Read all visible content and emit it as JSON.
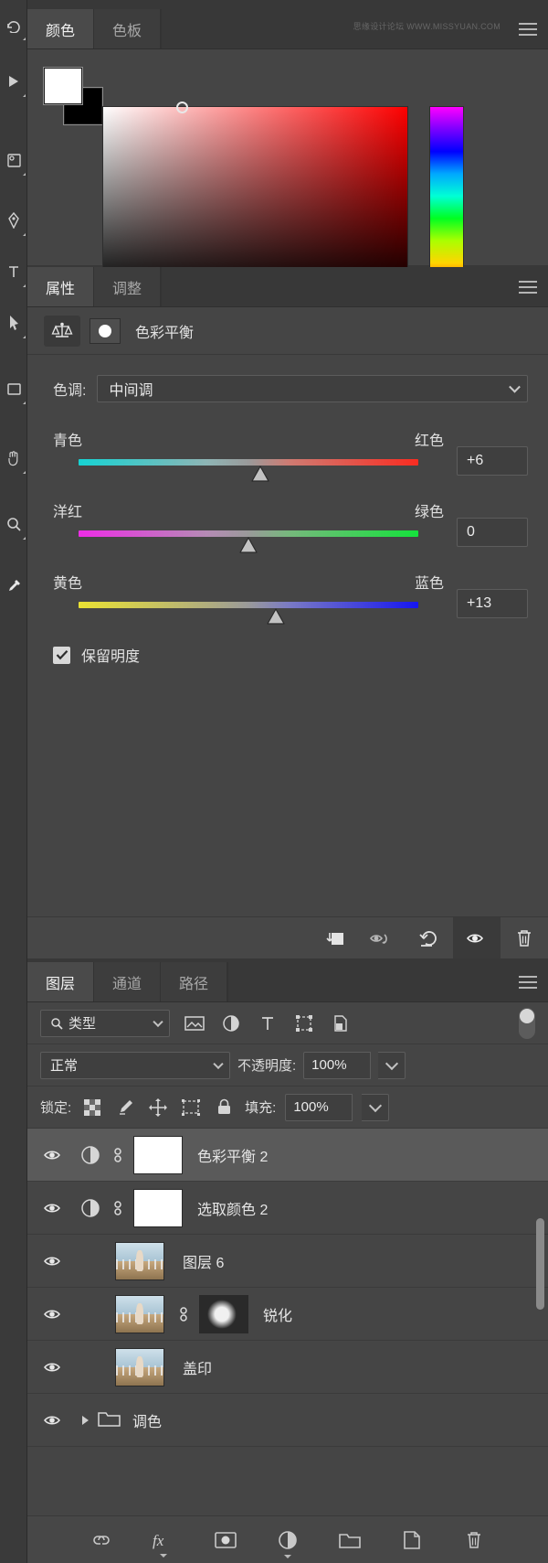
{
  "watermark": "思缘设计论坛  WWW.MISSYUAN.COM",
  "toolbar": {
    "tools": [
      {
        "name": "history-brush-tool"
      },
      {
        "name": "gradient-tool"
      },
      {
        "name": "dodge-tool"
      },
      {
        "name": "pen-tool"
      },
      {
        "name": "type-tool"
      },
      {
        "name": "path-selection-tool"
      },
      {
        "name": "rectangle-tool"
      },
      {
        "name": "hand-tool"
      },
      {
        "name": "zoom-tool"
      },
      {
        "name": "eyedropper-tool"
      }
    ]
  },
  "color_panel": {
    "tabs": [
      {
        "label": "颜色",
        "active": true
      },
      {
        "label": "色板",
        "active": false
      }
    ],
    "foreground_color": "#ffffff",
    "background_color": "#000000",
    "field_hue_color": "#fe0000",
    "menu_icon": "panel-menu-icon"
  },
  "properties_panel": {
    "tabs": [
      {
        "label": "属性",
        "active": true
      },
      {
        "label": "调整",
        "active": false
      }
    ],
    "adjustment_icon": "color-balance-icon",
    "title": "色彩平衡",
    "tone": {
      "label": "色调:",
      "value": "中间调"
    },
    "sliders": [
      {
        "name": "cyan-red",
        "left_label": "青色",
        "right_label": "红色",
        "value": "+6",
        "position_pct": 53
      },
      {
        "name": "magenta-green",
        "left_label": "洋红",
        "right_label": "绿色",
        "value": "0",
        "position_pct": 50
      },
      {
        "name": "yellow-blue",
        "left_label": "黄色",
        "right_label": "蓝色",
        "value": "+13",
        "position_pct": 57
      }
    ],
    "preserve_luminosity": {
      "label": "保留明度",
      "checked": true
    },
    "footer_buttons": [
      {
        "name": "clip-to-layer-button"
      },
      {
        "name": "toggle-preview-button"
      },
      {
        "name": "reset-button"
      },
      {
        "name": "visibility-eye-button",
        "active": true
      },
      {
        "name": "delete-adjustment-button"
      }
    ]
  },
  "layers_panel": {
    "tabs": [
      {
        "label": "图层",
        "active": true
      },
      {
        "label": "通道",
        "active": false
      },
      {
        "label": "路径",
        "active": false
      }
    ],
    "filter": {
      "label": "类型",
      "icons": [
        {
          "name": "filter-pixel-icon"
        },
        {
          "name": "filter-adjustment-icon"
        },
        {
          "name": "filter-type-icon"
        },
        {
          "name": "filter-shape-icon"
        },
        {
          "name": "filter-smart-object-icon"
        }
      ],
      "toggle_on": false
    },
    "blend_mode": "正常",
    "opacity_label": "不透明度:",
    "opacity_value": "100%",
    "lock_label": "锁定:",
    "lock_icons": [
      {
        "name": "lock-transparent-pixels-icon"
      },
      {
        "name": "lock-image-pixels-icon"
      },
      {
        "name": "lock-position-icon"
      },
      {
        "name": "lock-artboard-icon"
      },
      {
        "name": "lock-all-icon"
      }
    ],
    "fill_label": "填充:",
    "fill_value": "100%",
    "layers": [
      {
        "name": "色彩平衡 2",
        "visible": true,
        "selected": true,
        "kind": "adjustment",
        "has_link": true,
        "has_mask": true
      },
      {
        "name": "选取颜色 2",
        "visible": true,
        "selected": false,
        "kind": "adjustment",
        "has_link": true,
        "has_mask": true
      },
      {
        "name": "图层 6",
        "visible": true,
        "selected": false,
        "kind": "pixel",
        "has_link": false,
        "has_mask": false
      },
      {
        "name": "锐化",
        "visible": true,
        "selected": false,
        "kind": "pixel",
        "has_link": true,
        "has_mask": true
      },
      {
        "name": "盖印",
        "visible": true,
        "selected": false,
        "kind": "pixel",
        "has_link": false,
        "has_mask": false
      },
      {
        "name": "调色",
        "visible": true,
        "selected": false,
        "kind": "group",
        "has_link": false,
        "has_mask": false
      }
    ],
    "footer_buttons": [
      {
        "name": "link-layers-button"
      },
      {
        "name": "layer-style-button"
      },
      {
        "name": "add-layer-mask-button"
      },
      {
        "name": "new-adjustment-layer-button"
      },
      {
        "name": "new-group-button"
      },
      {
        "name": "new-layer-button"
      },
      {
        "name": "delete-layer-button"
      }
    ]
  }
}
